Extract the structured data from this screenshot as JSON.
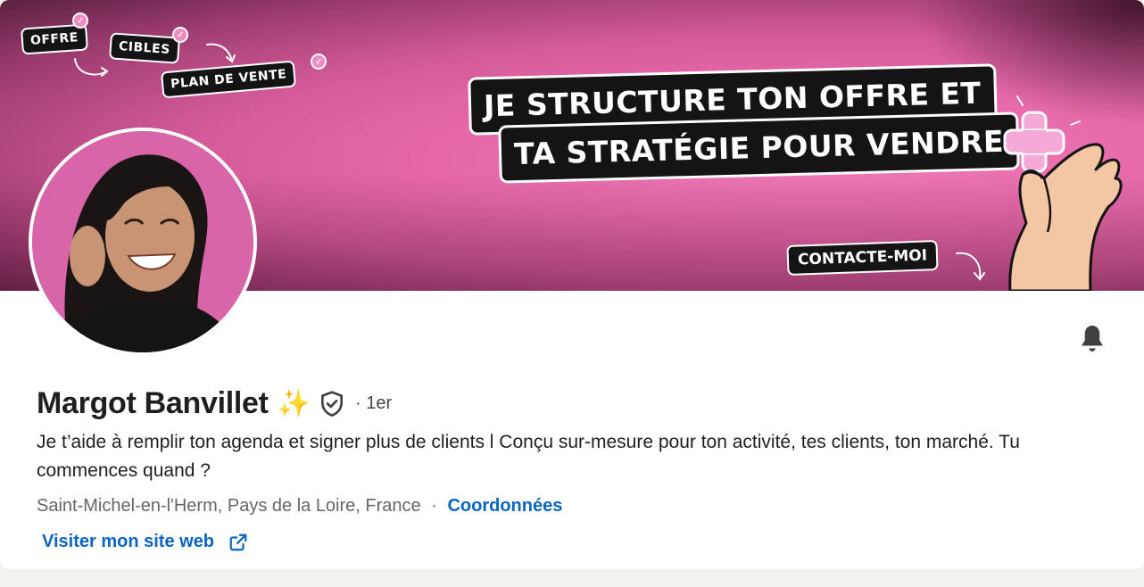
{
  "banner": {
    "tags": {
      "offre": "OFFRE",
      "cibles": "CIBLES",
      "plan": "PLAN DE VENTE",
      "contact": "CONTACTE-MOI"
    },
    "headline_line1": "JE STRUCTURE TON OFFRE ET",
    "headline_line2": "TA STRATÉGIE POUR VENDRE",
    "colors": {
      "pink": "#e567a8",
      "dark": "#141414",
      "accent_plus": "#f5a9d6"
    }
  },
  "profile": {
    "name": "Margot Banvillet",
    "sparkle": "✨",
    "degree": "· 1er",
    "headline": "Je t’aide à remplir ton agenda et signer plus de clients l Conçu sur-mesure pour ton activité, tes clients, ton marché. Tu commences quand ?",
    "location": "Saint-Michel-en-l'Herm, Pays de la Loire, France",
    "separator": "·",
    "contact_link": "Coordonnées",
    "website_link": "Visiter mon site web"
  },
  "icons": {
    "bell": "bell-icon",
    "shield": "verified-shield-icon",
    "external": "external-link-icon"
  },
  "colors": {
    "link": "#0a66c2",
    "text": "#1f1f1f",
    "muted": "#666666"
  }
}
